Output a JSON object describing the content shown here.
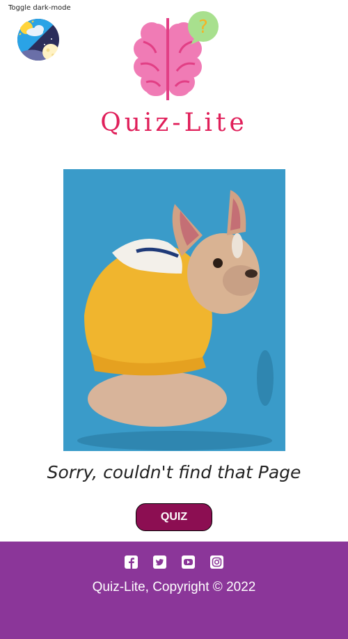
{
  "header": {
    "toggle_label": "Toggle dark-mode",
    "title": "Quiz-Lite"
  },
  "main": {
    "error_message": "Sorry, couldn't find that Page",
    "quiz_button_label": "QUIZ"
  },
  "footer": {
    "social_icons": [
      "facebook-icon",
      "twitter-icon",
      "youtube-icon",
      "instagram-icon"
    ],
    "copyright": "Quiz-Lite, Copyright © 2022"
  },
  "colors": {
    "title": "#e01f5a",
    "button_bg": "#8c0e52",
    "footer_bg": "#8b3699",
    "image_bg": "#3a9bc9"
  }
}
